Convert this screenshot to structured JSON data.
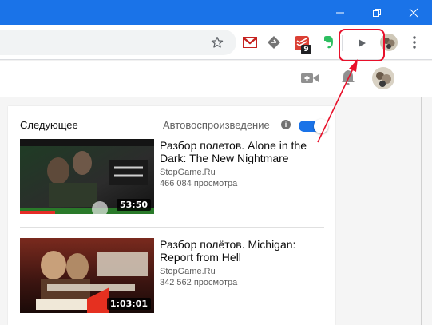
{
  "colors": {
    "titlebar": "#1a73e8",
    "accent": "#1a73e8",
    "highlight": "#e8102a"
  },
  "titlebar": {
    "icons": [
      "minimize-icon",
      "restore-icon",
      "close-icon"
    ]
  },
  "toolbar": {
    "icons": [
      "star-icon",
      "gmail-icon",
      "extension-icon",
      "todoist-icon",
      "evernote-icon",
      "play-icon",
      "profile-avatar",
      "more-vert-icon"
    ],
    "todoist_badge": "9"
  },
  "yt_header": {
    "icons": [
      "create-video-icon",
      "notifications-icon",
      "avatar"
    ]
  },
  "sidebar": {
    "up_next_label": "Следующее",
    "autoplay_label": "Автовоспроизведение",
    "info_glyph": "i",
    "autoplay_on": true
  },
  "videos": [
    {
      "title": "Разбор полетов. Alone in the Dark: The New Nightmare",
      "channel": "StopGame.Ru",
      "views": "466 084 просмотра",
      "duration": "53:50"
    },
    {
      "title": "Разбор полётов. Michigan: Report from Hell",
      "channel": "StopGame.Ru",
      "views": "342 562 просмотра",
      "duration": "1:03:01"
    }
  ]
}
